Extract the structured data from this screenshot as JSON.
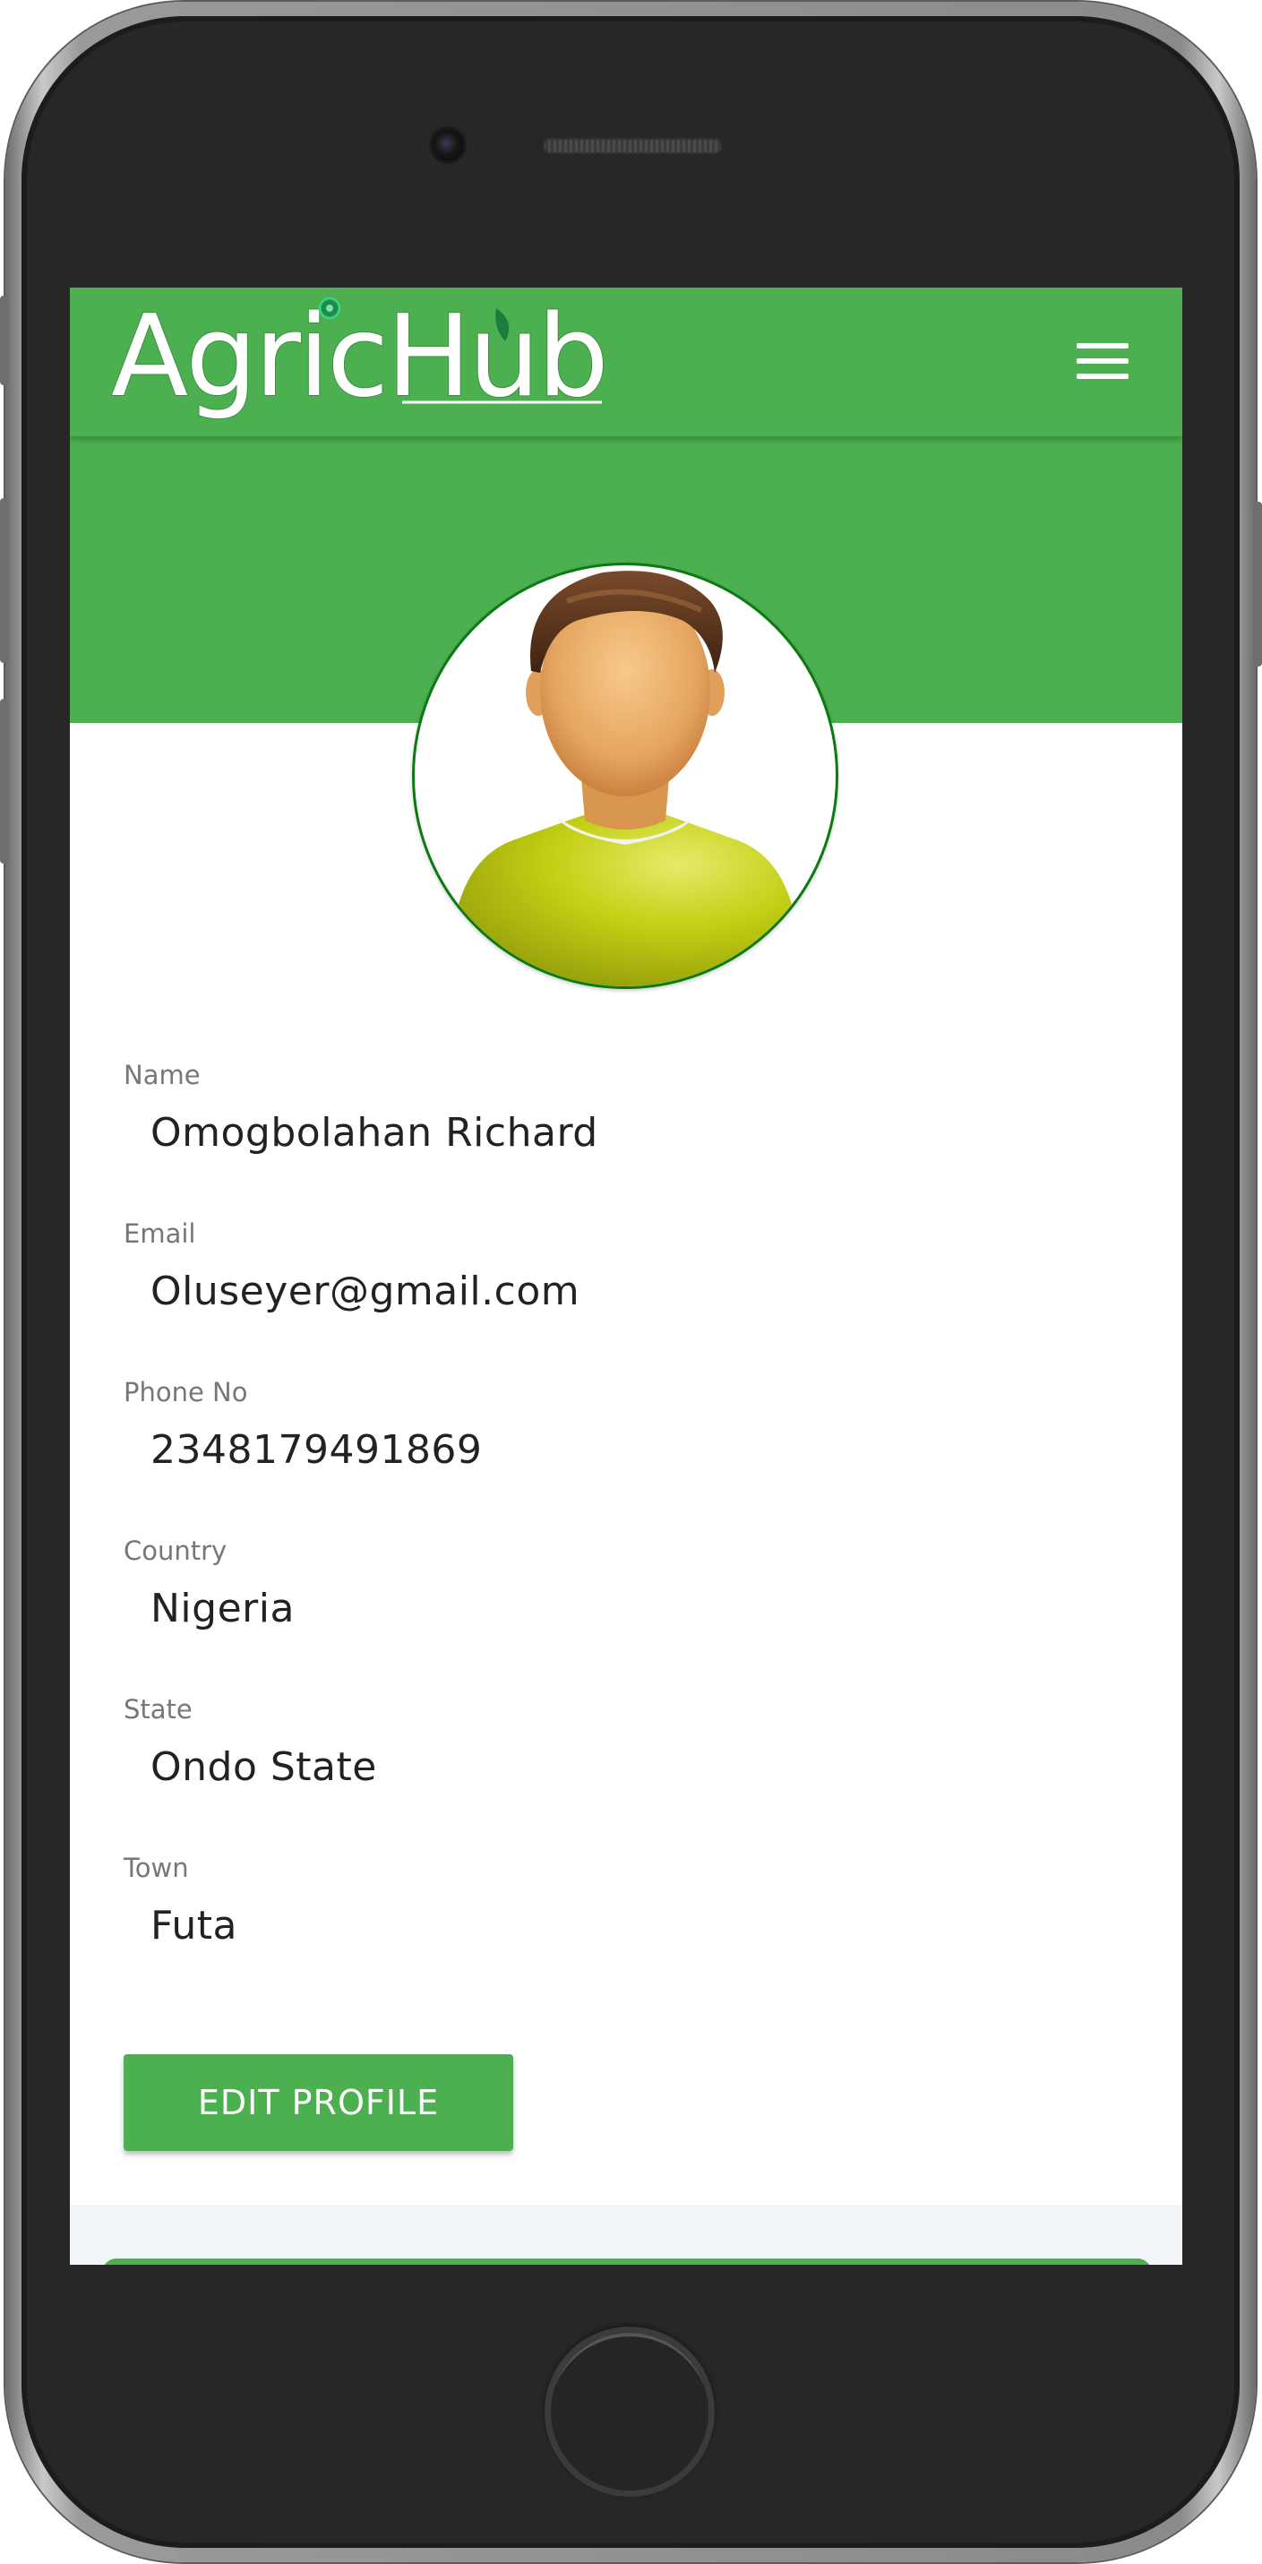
{
  "app": {
    "brand": {
      "text_part1": "Agric",
      "text_part2": "Hub",
      "logo_name": "agrichub-logo"
    },
    "menu_icon": "hamburger-menu-icon",
    "colors": {
      "primary": "#4caf50",
      "avatar_border": "#0b7a12",
      "label": "#777777",
      "value": "#222222"
    }
  },
  "profile": {
    "avatar_icon": "user-avatar-placeholder",
    "fields": [
      {
        "label": "Name",
        "value": "Omogbolahan Richard"
      },
      {
        "label": "Email",
        "value": "Oluseyer@gmail.com"
      },
      {
        "label": "Phone No",
        "value": "2348179491869"
      },
      {
        "label": "Country",
        "value": "Nigeria"
      },
      {
        "label": "State",
        "value": "Ondo State"
      },
      {
        "label": "Town",
        "value": "Futa"
      }
    ],
    "edit_button_label": "EDIT PROFILE"
  }
}
